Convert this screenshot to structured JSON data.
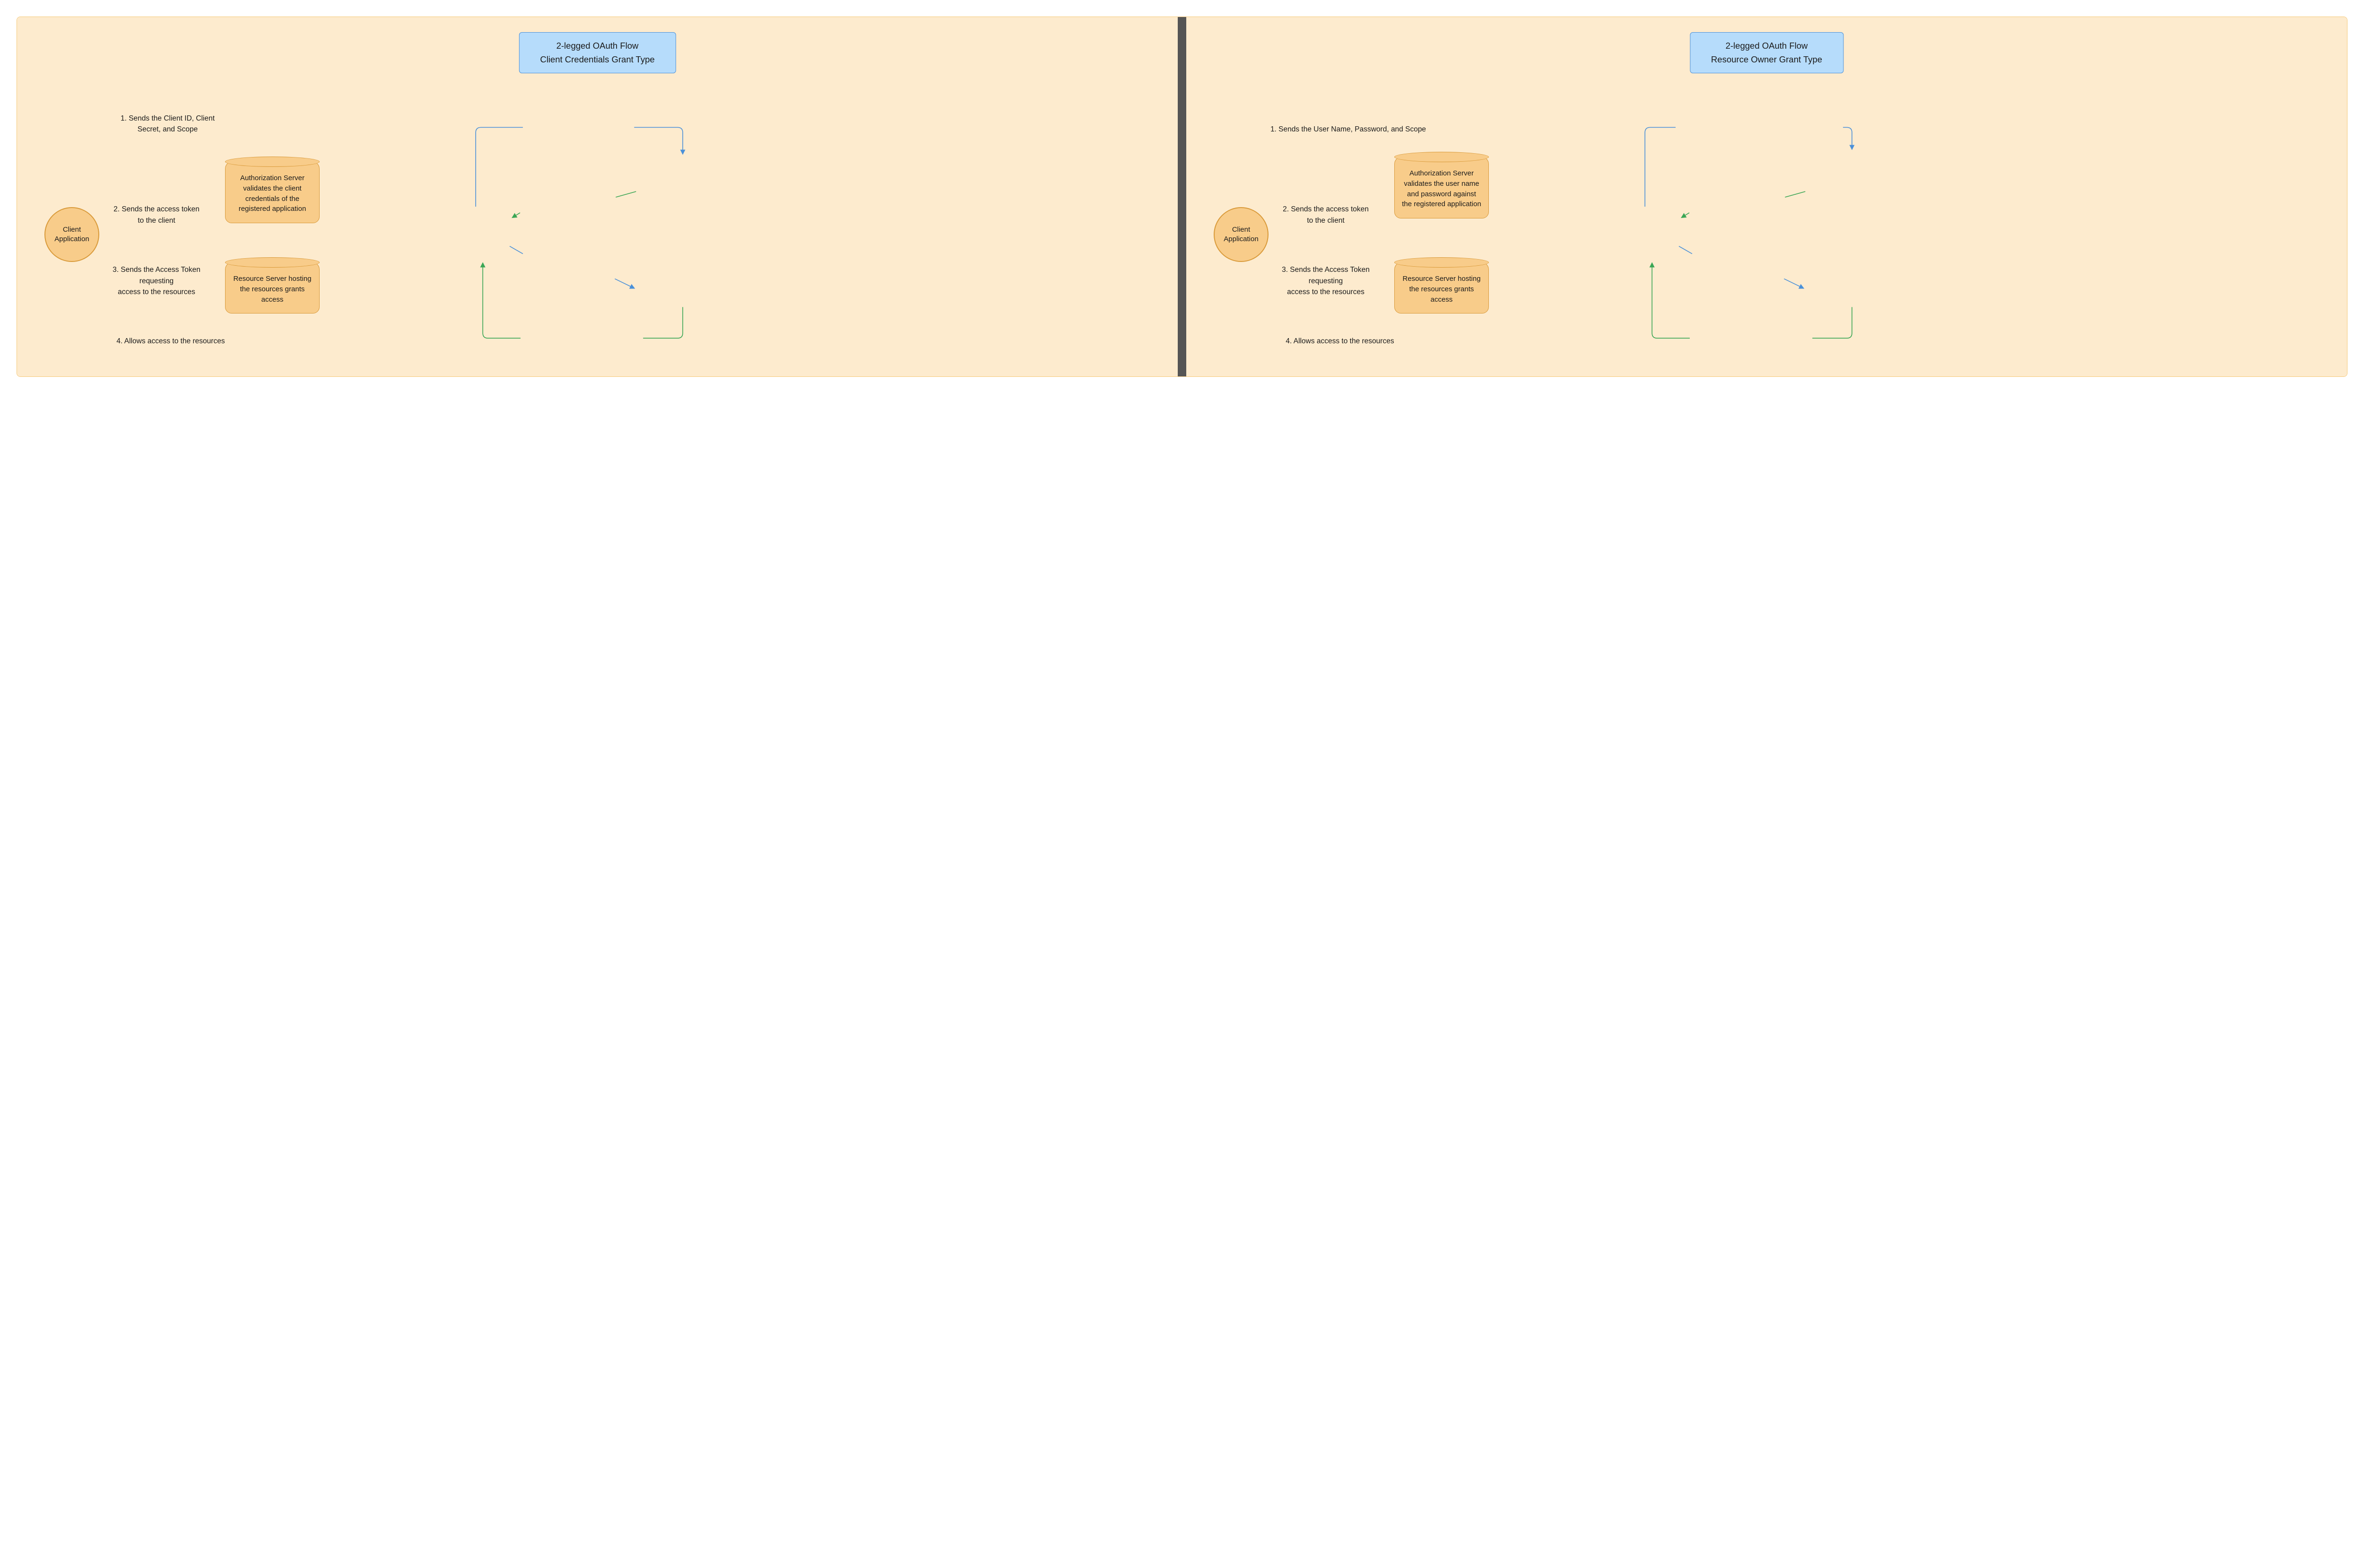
{
  "left": {
    "title_line1": "2-legged OAuth Flow",
    "title_line2": "Client Credentials Grant Type",
    "client_label_1": "Client",
    "client_label_2": "Application",
    "auth_server": "Authorization Server validates the client credentials of the registered application",
    "resource_server": "Resource Server hosting the resources grants access",
    "step1": "1. Sends the Client ID, Client Secret, and Scope",
    "step2": "2. Sends the access token\nto the client",
    "step3": "3. Sends the Access Token requesting\naccess to the resources",
    "step4": "4. Allows access to the resources"
  },
  "right": {
    "title_line1": "2-legged OAuth Flow",
    "title_line2": "Resource Owner Grant Type",
    "client_label_1": "Client",
    "client_label_2": "Application",
    "auth_server": "Authorization Server validates the user name and password against the registered application",
    "resource_server": "Resource Server hosting the resources grants access",
    "step1": "1. Sends the User Name, Password, and Scope",
    "step2": "2. Sends the access token\nto the client",
    "step3": "3. Sends the Access Token requesting\naccess to the resources",
    "step4": "4. Allows access to the resources"
  },
  "colors": {
    "blue_arrow": "#4a90d9",
    "green_arrow": "#3aa655"
  }
}
